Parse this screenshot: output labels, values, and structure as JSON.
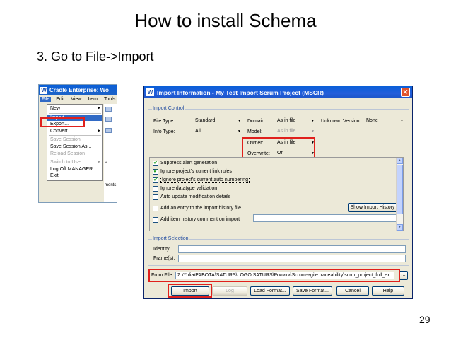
{
  "slide": {
    "title": "How to install Schema",
    "step": "3. Go to File->Import",
    "page_number": "29"
  },
  "app": {
    "title": "Cradle Enterprise: Wo",
    "menu": [
      "File",
      "Edit",
      "View",
      "Item",
      "Tools"
    ],
    "file_menu": [
      {
        "label": "New",
        "submenu": true,
        "state": "normal"
      },
      {
        "label": "Import...",
        "submenu": false,
        "state": "selected"
      },
      {
        "label": "Export...",
        "submenu": false,
        "state": "normal"
      },
      {
        "label": "Convert",
        "submenu": true,
        "state": "normal"
      },
      {
        "label": "Save Session",
        "submenu": false,
        "state": "disabled"
      },
      {
        "label": "Save Session As...",
        "submenu": false,
        "state": "normal"
      },
      {
        "label": "Reload Session",
        "submenu": false,
        "state": "disabled"
      },
      {
        "label": "Switch to User",
        "submenu": true,
        "state": "disabled"
      },
      {
        "label": "Log Off MANAGER",
        "submenu": false,
        "state": "normal"
      },
      {
        "label": "Exit",
        "submenu": false,
        "state": "normal"
      }
    ],
    "side_fragments": [
      "st",
      "ments"
    ]
  },
  "dialog": {
    "title": "Import Information - My Test Import Scrum Project (MSCR)",
    "import_control": {
      "label": "Import Control",
      "file_type_label": "File Type:",
      "file_type_value": "Standard",
      "info_type_label": "Info Type:",
      "info_type_value": "All",
      "domain_label": "Domain:",
      "domain_value": "As in file",
      "model_label": "Model:",
      "model_value": "As in file",
      "owner_label": "Owner:",
      "owner_value": "As in file",
      "overwrite_label": "Overwrite:",
      "overwrite_value": "On",
      "unknown_version_label": "Unknown Version:",
      "unknown_version_value": "None"
    },
    "options": [
      {
        "label": "Suppress alert generation",
        "checked": true
      },
      {
        "label": "Ignore project's current link rules",
        "checked": true
      },
      {
        "label": "Ignore project's current auto numbering",
        "checked": true
      },
      {
        "label": "Ignore datatype validation",
        "checked": false
      },
      {
        "label": "Auto update modification details",
        "checked": false
      },
      {
        "label": "Add an entry to the import history file",
        "checked": false
      },
      {
        "label": "Add item history comment on import",
        "checked": false
      }
    ],
    "show_history_label": "Show Import History",
    "import_selection": {
      "label": "Import Selection",
      "identity_label": "Identity:",
      "frames_label": "Frame(s):"
    },
    "from_file_label": "From File:",
    "from_file_value": "Z:\\Yulia\\РАБОТА\\SATURS\\LOGO SATURS\\Ролики\\Scrum-agile traceability\\scrm_project_full_ex",
    "buttons": {
      "import": "Import",
      "log": "Log",
      "load_format": "Load Format...",
      "save_format": "Save Format...",
      "cancel": "Cancel",
      "help": "Help"
    }
  },
  "colors": {
    "highlight": "#e0201c",
    "titlebar": "#245edb",
    "selection": "#316ac5"
  }
}
